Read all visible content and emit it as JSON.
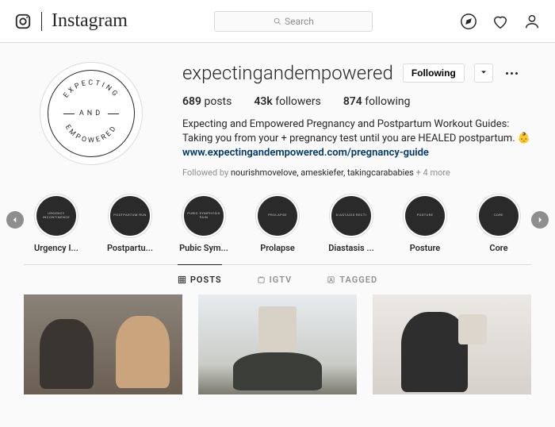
{
  "nav": {
    "brand": "Instagram",
    "search_placeholder": "Search"
  },
  "profile": {
    "avatar_word1": "EXPECTING",
    "avatar_center": "AND",
    "avatar_word2": "EMPOWERED",
    "username": "expectingandempowered",
    "follow_button": "Following",
    "posts_count": "689",
    "posts_label": "posts",
    "followers_count": "43k",
    "followers_label": "followers",
    "following_count": "874",
    "following_label": "following",
    "bio_line": "Expecting and Empowered Pregnancy and Postpartum Workout Guides: Taking you from your + pregnancy test until you are HEALED postpartum. 👶",
    "bio_link": "www.expectingandempowered.com/pregnancy-guide",
    "followed_by_prefix": "Followed by ",
    "followed_by_names": "nourishmovelove, ameskiefer, takingcarababies",
    "followed_by_suffix": " + 4 more"
  },
  "highlights": [
    {
      "inner": "Urgency Incontinence",
      "label": "Urgency I..."
    },
    {
      "inner": "Postpartum Run",
      "label": "Postpartu..."
    },
    {
      "inner": "Pubic Symphysis Pain",
      "label": "Pubic Sym..."
    },
    {
      "inner": "Prolapse",
      "label": "Prolapse"
    },
    {
      "inner": "Diastasis Recti",
      "label": "Diastasis ..."
    },
    {
      "inner": "Posture",
      "label": "Posture"
    },
    {
      "inner": "Core",
      "label": "Core"
    }
  ],
  "tabs": {
    "posts": "POSTS",
    "igtv": "IGTV",
    "tagged": "TAGGED"
  }
}
